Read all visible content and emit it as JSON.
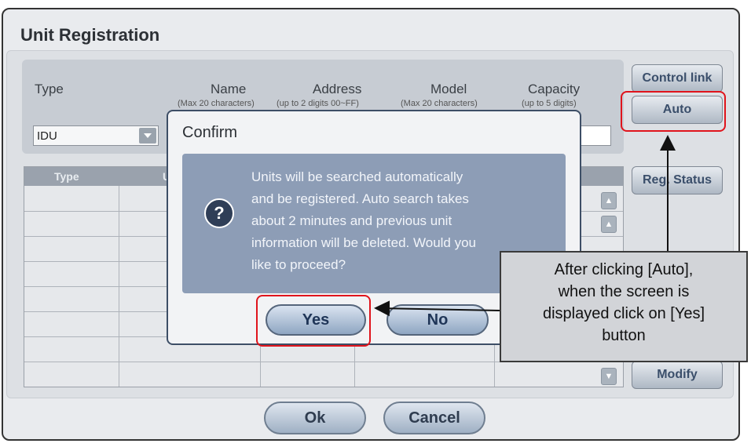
{
  "window": {
    "title": "Unit Registration"
  },
  "form": {
    "columns": [
      {
        "label": "Type",
        "hint": ""
      },
      {
        "label": "Name",
        "hint": "(Max 20 characters)"
      },
      {
        "label": "Address",
        "hint": "(up to 2 digits 00~FF)"
      },
      {
        "label": "Model",
        "hint": "(Max 20 characters)"
      },
      {
        "label": "Capacity",
        "hint": "(up to 5 digits)"
      }
    ],
    "type_select_value": "IDU"
  },
  "table": {
    "headers": [
      "Type",
      "U"
    ]
  },
  "side_buttons": {
    "control_link": "Control link",
    "auto": "Auto",
    "reg_status": "Reg. Status",
    "modify": "Modify"
  },
  "footer": {
    "ok": "Ok",
    "cancel": "Cancel"
  },
  "dialog": {
    "title": "Confirm",
    "message": "Units will be searched automatically\nand be registered.  Auto search takes\nabout 2 minutes and previous unit\ninformation will be deleted.  Would you\nlike to proceed?",
    "icon": "question-icon",
    "yes": "Yes",
    "no": "No"
  },
  "annotation": {
    "text": "After clicking [Auto],\nwhen the screen is\ndisplayed click on [Yes]\nbutton",
    "highlight_color": "#e0141c"
  }
}
